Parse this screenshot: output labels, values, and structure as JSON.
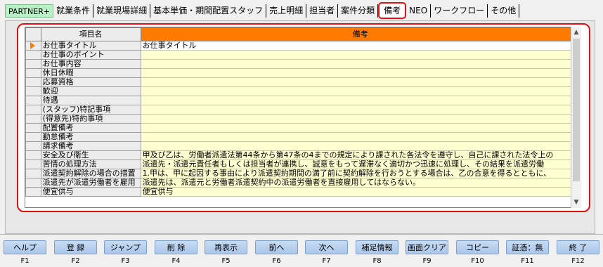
{
  "tabs": [
    {
      "label": "PARTNER+",
      "active": false
    },
    {
      "label": "就業条件",
      "active": false
    },
    {
      "label": "就業現場詳細",
      "active": false
    },
    {
      "label": "基本単価・期間配置スタッフ",
      "active": false
    },
    {
      "label": "売上明細",
      "active": false
    },
    {
      "label": "担当者",
      "active": false
    },
    {
      "label": "案件分類",
      "active": false
    },
    {
      "label": "備考",
      "active": true
    },
    {
      "label": "NEO",
      "active": false
    },
    {
      "label": "ワークフロー",
      "active": false
    },
    {
      "label": "その他",
      "active": false
    }
  ],
  "grid": {
    "header_name": "項目名",
    "header_value": "備考",
    "rows": [
      {
        "name": "お仕事タイトル",
        "value": "お仕事タイトル",
        "selected": true
      },
      {
        "name": "お仕事のポイント",
        "value": ""
      },
      {
        "name": "お仕事内容",
        "value": ""
      },
      {
        "name": "休日休暇",
        "value": ""
      },
      {
        "name": "応募資格",
        "value": ""
      },
      {
        "name": "歓迎",
        "value": ""
      },
      {
        "name": "待遇",
        "value": ""
      },
      {
        "name": "(スタッフ)特記事項",
        "value": ""
      },
      {
        "name": "(得意先)特約事項",
        "value": ""
      },
      {
        "name": "配置備考",
        "value": ""
      },
      {
        "name": "勤怠備考",
        "value": ""
      },
      {
        "name": "請求備考",
        "value": ""
      },
      {
        "name": "安全及び衛生",
        "value": "甲及び乙は、労働者派遣法第44条から第47条の4までの規定により課された各法令を遵守し、自己に課された法令上の"
      },
      {
        "name": "苦情の処理方法",
        "value": "派遣先・派遣元責任者もしくは担当者が連携し、誠意をもって遅滞なく適切かつ迅速に処理し、その結果を派遣労働"
      },
      {
        "name": "派遣契約解除の場合の措置",
        "value": "1.甲は、甲に起因する事由により派遣契約期間の満了前に契約解除を行おうとする場合は、乙の合意を得るとともに、"
      },
      {
        "name": "派遣先が派遣労働者を雇用",
        "value": "派遣先は、派遣元と労働者派遣契約中の派遣労働者を直接雇用してはならない。"
      },
      {
        "name": "便宜供与",
        "value": "便宜供与"
      }
    ]
  },
  "function_keys": [
    {
      "label": "ヘルプ",
      "key": "F1"
    },
    {
      "label": "登 録",
      "key": "F2"
    },
    {
      "label": "ジャンプ",
      "key": "F3"
    },
    {
      "label": "削 除",
      "key": "F4"
    },
    {
      "label": "再表示",
      "key": "F5"
    },
    {
      "label": "前へ",
      "key": "F6"
    },
    {
      "label": "次へ",
      "key": "F7"
    },
    {
      "label": "補足情報",
      "key": "F8"
    },
    {
      "label": "画面クリア",
      "key": "F9"
    },
    {
      "label": "コピー",
      "key": "F10"
    },
    {
      "label": "証憑：無",
      "key": "F11"
    },
    {
      "label": "終 了",
      "key": "F12"
    }
  ],
  "colors": {
    "accent_orange": "#ff7a00",
    "highlight_red": "#e01010",
    "cell_yellow": "#ffffd2",
    "fkey_blue": "#a9c6ea",
    "partner_tab_green": "#b9f0c6"
  }
}
